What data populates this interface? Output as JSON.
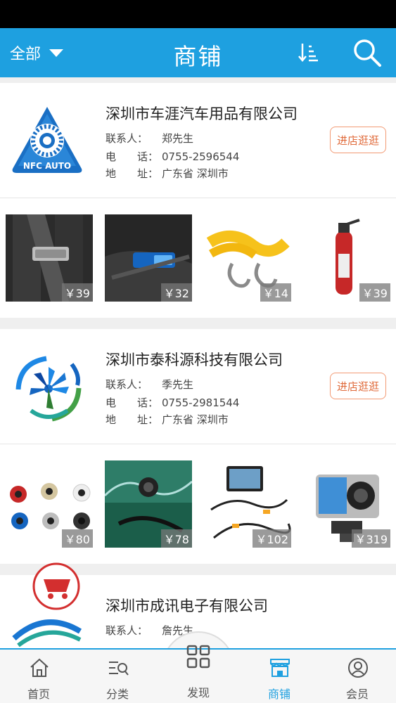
{
  "header": {
    "filter_label": "全部",
    "title": "商铺",
    "sort_icon": "sort-icon",
    "search_icon": "search-icon"
  },
  "shops": [
    {
      "name": "深圳市车涯汽车用品有限公司",
      "contact_label": "联系人：",
      "contact": "郑先生",
      "phone_label": "电　　话：",
      "phone": "0755-2596544",
      "address_label": "地　　址：",
      "address": "广东省 深圳市",
      "logo_text": "NFC AUTO",
      "visit_label": "进店逛逛",
      "products": [
        {
          "price": "￥39",
          "icon": "seatbelt-clip"
        },
        {
          "price": "￥32",
          "icon": "seatbelt-buckle"
        },
        {
          "price": "￥14",
          "icon": "tow-rope"
        },
        {
          "price": "￥39",
          "icon": "fire-extinguisher"
        }
      ]
    },
    {
      "name": "深圳市泰科源科技有限公司",
      "contact_label": "联系人：",
      "contact": "季先生",
      "phone_label": "电　　话：",
      "phone": "0755-2981544",
      "address_label": "地　　址：",
      "address": "广东省 深圳市",
      "visit_label": "进店逛逛",
      "products": [
        {
          "price": "￥80",
          "icon": "parking-sensors"
        },
        {
          "price": "￥78",
          "icon": "waterproof-camera"
        },
        {
          "price": "￥102",
          "icon": "car-monitor"
        },
        {
          "price": "￥319",
          "icon": "action-camera"
        }
      ]
    },
    {
      "name": "深圳市成讯电子有限公司",
      "contact_label": "联系人：",
      "contact": "詹先生"
    }
  ],
  "tabbar": {
    "items": [
      {
        "label": "首页",
        "icon": "home-icon"
      },
      {
        "label": "分类",
        "icon": "category-icon"
      },
      {
        "label": "发现",
        "icon": "grid-icon"
      },
      {
        "label": "商铺",
        "icon": "shop-icon",
        "active": true
      },
      {
        "label": "会员",
        "icon": "user-icon"
      }
    ]
  },
  "colors": {
    "primary": "#1ea0e0",
    "visit_border": "#f29a74",
    "visit_text": "#e06a3a"
  }
}
